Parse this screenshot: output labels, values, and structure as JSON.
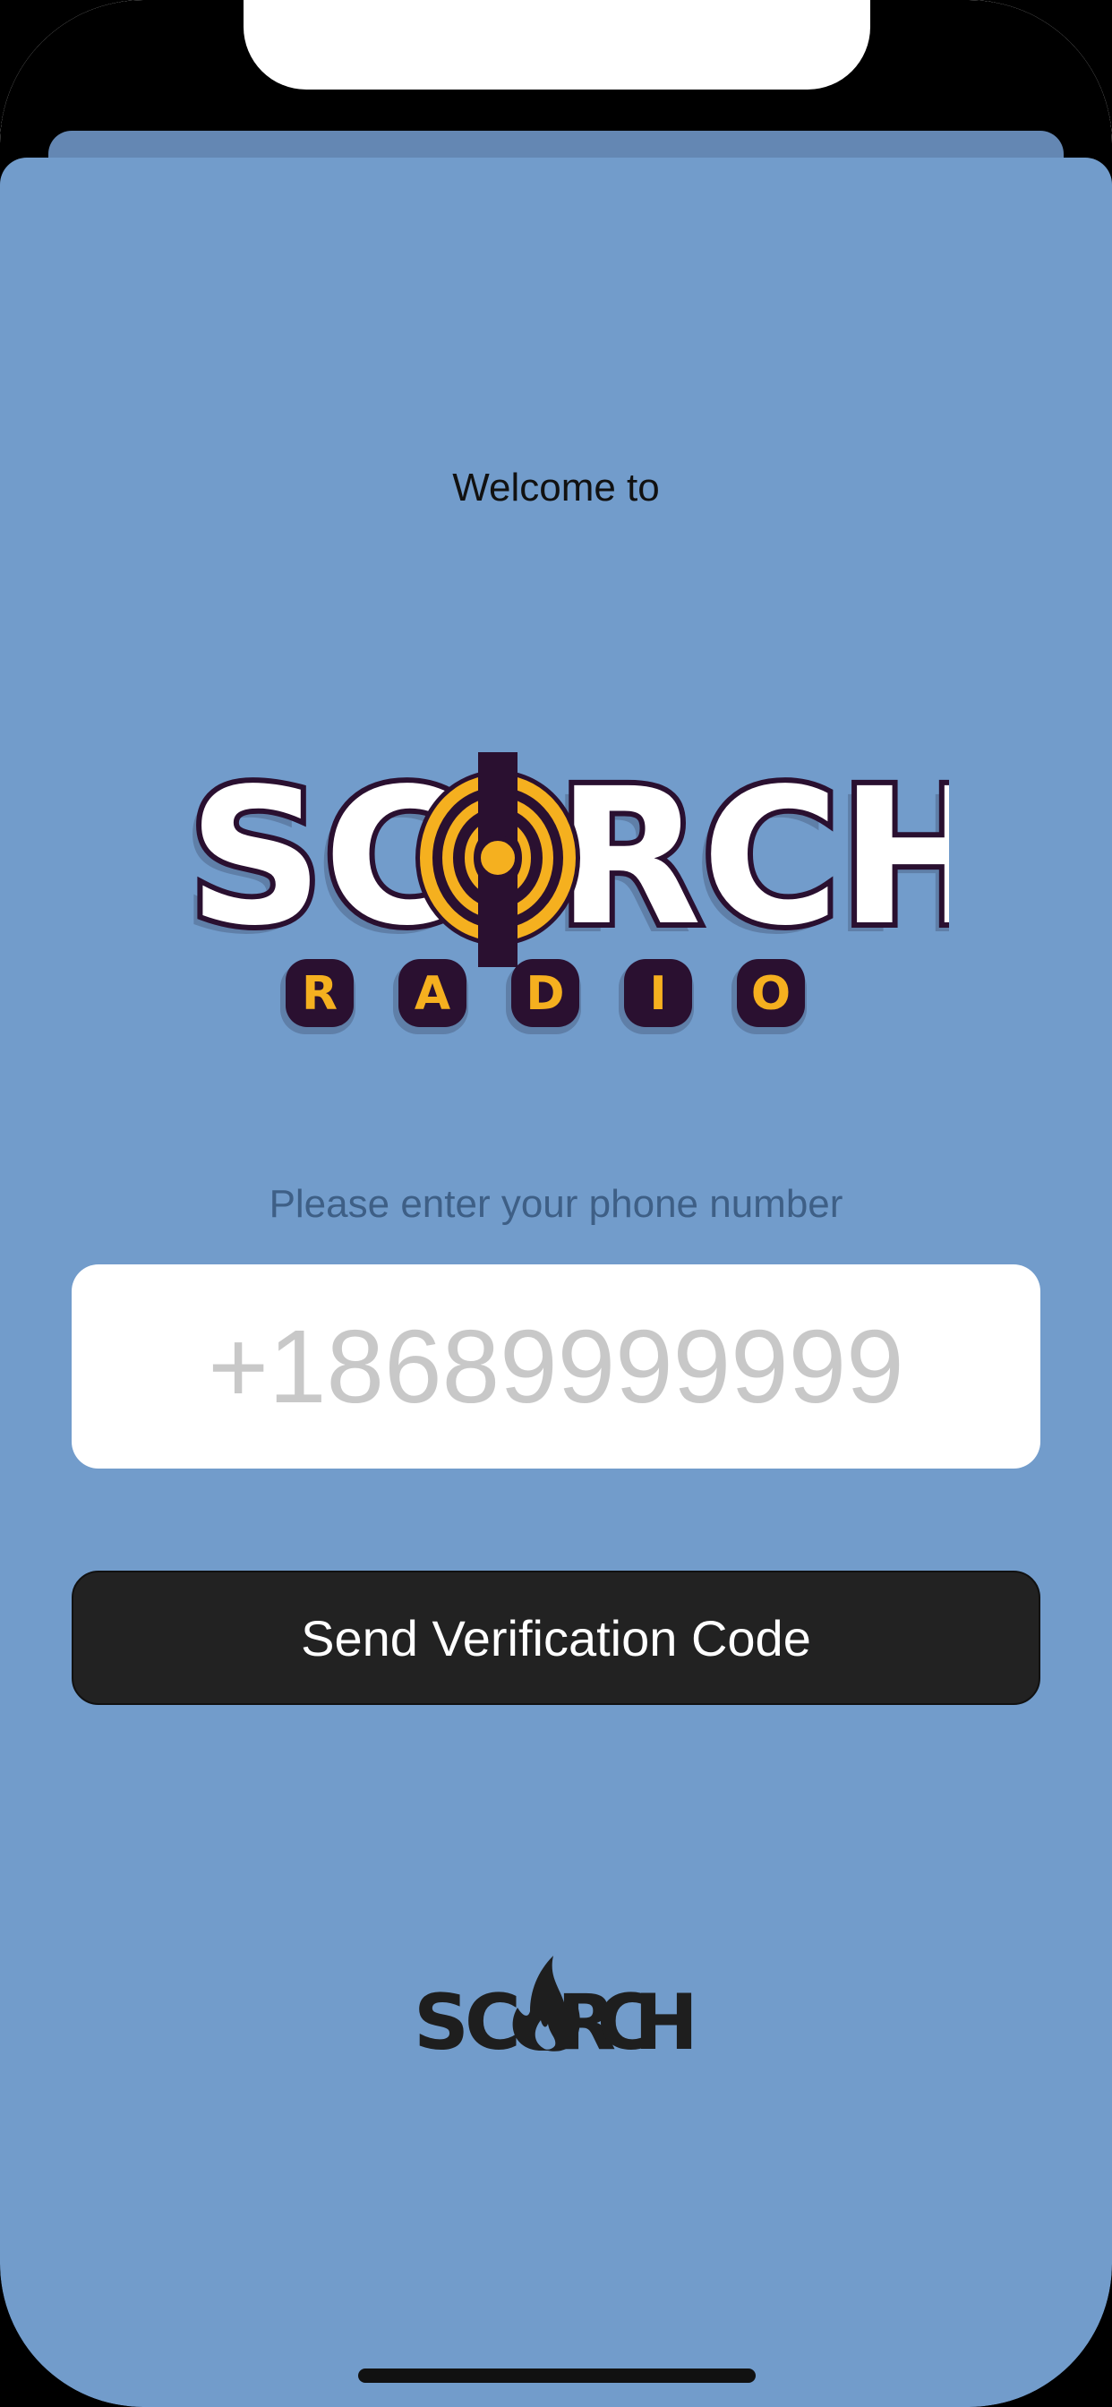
{
  "welcome_text": "Welcome to",
  "logo": {
    "word": "SCORCH",
    "sub": "RADIO",
    "letters_left": "SC",
    "letters_right": "RCH",
    "sub_letters": [
      "R",
      "A",
      "D",
      "I",
      "O"
    ]
  },
  "phone": {
    "prompt": "Please enter your phone number",
    "placeholder": "+18689999999",
    "value": ""
  },
  "send_button": {
    "label": "Send Verification Code"
  },
  "footer_logo": {
    "letters_left": "SC",
    "letters_right": "RCH"
  },
  "colors": {
    "screen_background": "#729ccb",
    "button_background": "#222222",
    "logo_yellow": "#f5b01f",
    "logo_outline": "#2a1030"
  }
}
